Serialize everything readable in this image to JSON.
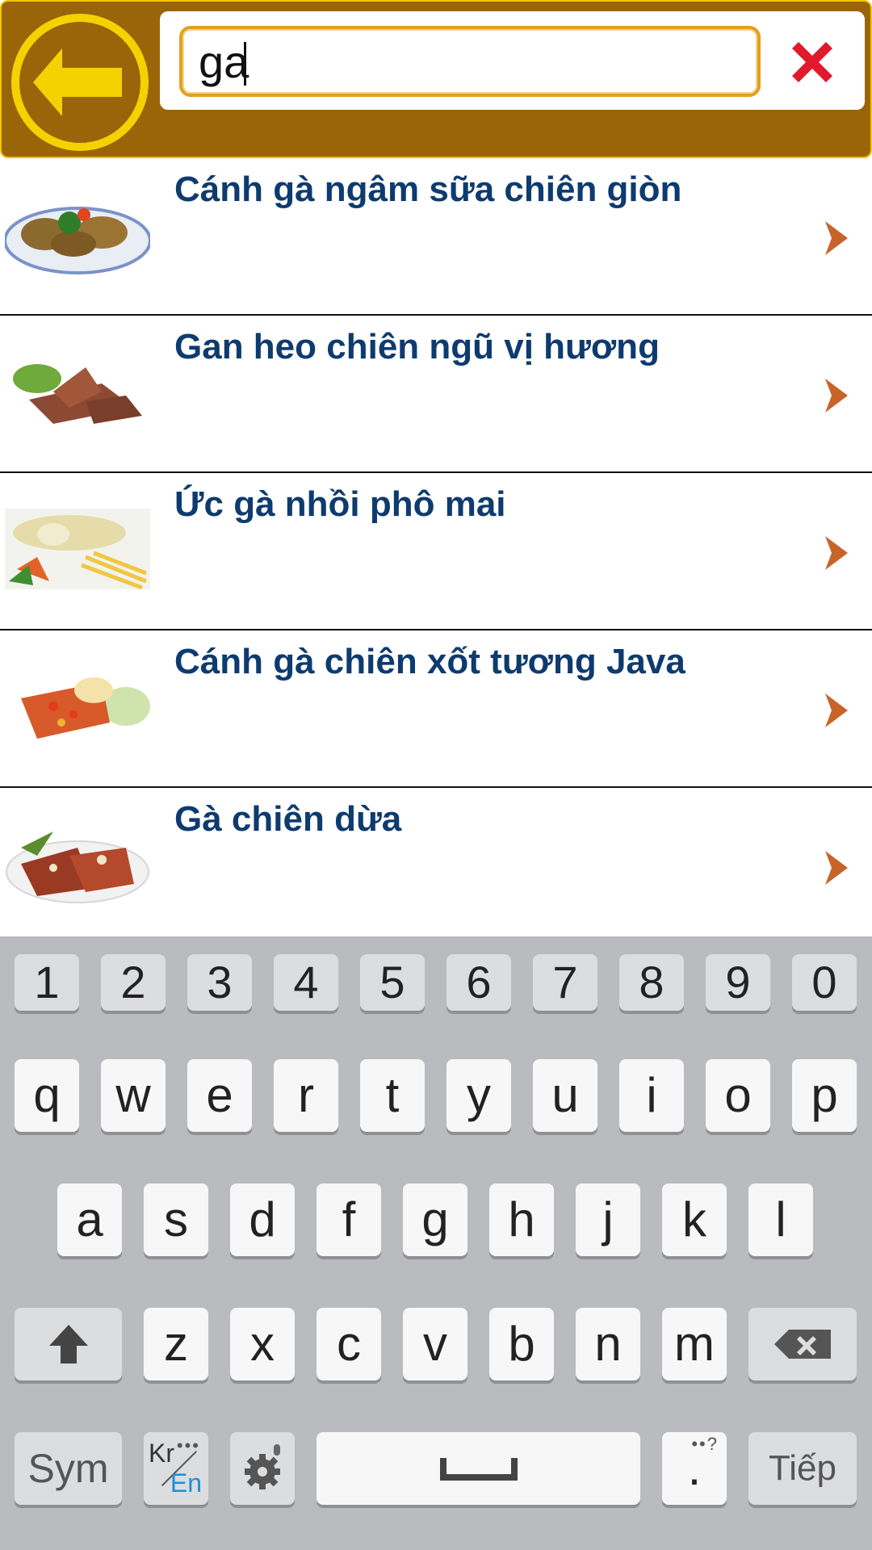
{
  "header": {
    "search_value": "ga",
    "colors": {
      "bar": "#9a6509",
      "accent": "#f3d200",
      "clear": "#e0192b"
    }
  },
  "results": [
    {
      "title": "Cánh gà ngâm sữa chiên giòn"
    },
    {
      "title": "Gan heo chiên ngũ vị hương"
    },
    {
      "title": "Ức gà nhồi phô mai"
    },
    {
      "title": "Cánh gà chiên xốt tương Java"
    },
    {
      "title": "Gà chiên dừa"
    }
  ],
  "keyboard": {
    "numbers": [
      "1",
      "2",
      "3",
      "4",
      "5",
      "6",
      "7",
      "8",
      "9",
      "0"
    ],
    "row1": [
      "q",
      "w",
      "e",
      "r",
      "t",
      "y",
      "u",
      "i",
      "o",
      "p"
    ],
    "row2": [
      "a",
      "s",
      "d",
      "f",
      "g",
      "h",
      "j",
      "k",
      "l"
    ],
    "row3": [
      "z",
      "x",
      "c",
      "v",
      "b",
      "n",
      "m"
    ],
    "sym_label": "Sym",
    "lang_top": "Kr",
    "lang_bottom": "En",
    "period_label": ".",
    "period_hint": "?",
    "next_label": "Tiếp"
  }
}
